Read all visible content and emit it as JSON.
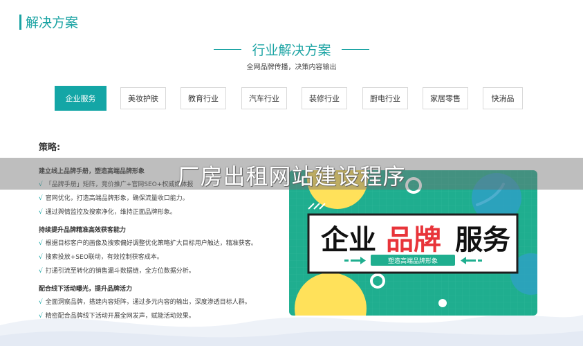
{
  "section": {
    "title": "解决方案"
  },
  "hero": {
    "title": "行业解决方案",
    "subtitle": "全网品牌传播，决策内容输出"
  },
  "tabs": [
    {
      "label": "企业服务",
      "active": true
    },
    {
      "label": "美妆护肤"
    },
    {
      "label": "教育行业"
    },
    {
      "label": "汽车行业"
    },
    {
      "label": "装修行业"
    },
    {
      "label": "厨电行业"
    },
    {
      "label": "家居零售"
    },
    {
      "label": "快消品"
    }
  ],
  "strategy": {
    "title": "策略:",
    "groups": [
      {
        "title": "建立线上品牌手册，塑造高端品牌形象",
        "items": [
          "「品牌手册」矩阵，竞价推广+官网SEO+权威媒体报",
          "官网优化，打造高端品牌形象，确保流量收口能力。",
          "通过舆情监控及搜索净化，维持正面品牌形象。"
        ]
      },
      {
        "title": "持续提升品牌精准高效获客能力",
        "items": [
          "根据目标客户的画像及搜索偏好调整优化策略扩大目标用户触达，精准获客。",
          "搜索投放+SEO联动，有效控制获客成本。",
          "打通引流至转化的销售漏斗数据链，全方位数据分析。"
        ]
      },
      {
        "title": "配合线下活动曝光，提升品牌活力",
        "items": [
          "全面洞察品牌，搭建内容矩阵，通过多元内容的输出，深度渗透目标人群。",
          "精密配合品牌线下活动开展全网发声，赋能活动效果。"
        ]
      }
    ],
    "check_mark": "√"
  },
  "poster": {
    "word1": "企业",
    "word2": "品牌",
    "word3": "服务",
    "tagline": "塑造高端品牌形象"
  },
  "banner": {
    "text": "厂房出租网站建设程序"
  },
  "colors": {
    "accent": "#14a6a6",
    "poster_bg": "#1fae8f",
    "poster_red": "#e8343a"
  }
}
